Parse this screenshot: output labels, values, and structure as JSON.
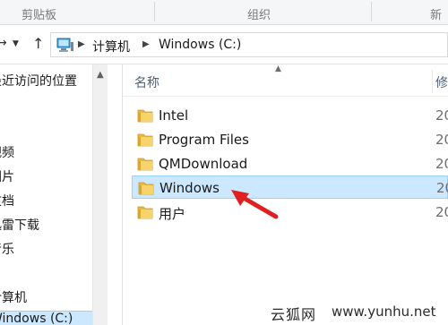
{
  "ribbon": {
    "groups": [
      "剪贴板",
      "组织",
      "新"
    ]
  },
  "navbar": {
    "back_arrow": "←",
    "forward_arrow": "→",
    "up_arrow": "↑",
    "breadcrumb": [
      "计算机",
      "Windows (C:)"
    ]
  },
  "navpane": {
    "items": [
      "最近访问的位置",
      "视频",
      "图片",
      "文档",
      "迅雷下载",
      "音乐",
      "计算机",
      "Windows (C:)"
    ]
  },
  "filelist": {
    "columns": {
      "name": "名称",
      "date": "修"
    },
    "rows": [
      {
        "name": "Intel",
        "date": "20"
      },
      {
        "name": "Program Files",
        "date": "20"
      },
      {
        "name": "QMDownload",
        "date": "20"
      },
      {
        "name": "Windows",
        "date": "20",
        "selected": true
      },
      {
        "name": "用户",
        "date": "20"
      }
    ]
  },
  "watermark": {
    "brand": "云狐网",
    "url": "www.yunhu.net"
  },
  "colors": {
    "selection_bg": "#cce8ff",
    "selection_border": "#99d1ff",
    "folder_yellow": "#e8b93f",
    "annotation_red": "#e02020"
  }
}
